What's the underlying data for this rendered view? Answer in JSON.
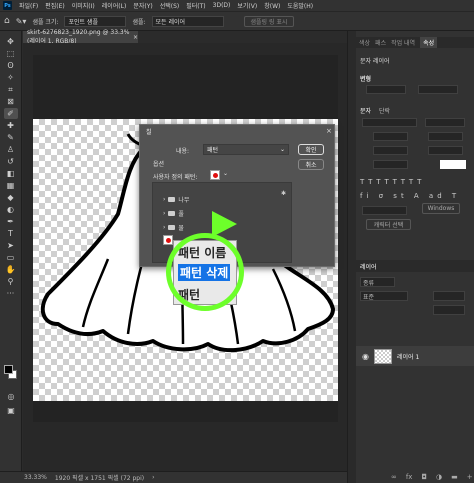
{
  "app": {
    "logo_text": "Ps"
  },
  "menubar": {
    "items": [
      "파일(F)",
      "편집(E)",
      "이미지(I)",
      "레이어(L)",
      "문자(Y)",
      "선택(S)",
      "필터(T)",
      "3D(D)",
      "보기(V)",
      "창(W)",
      "도움말(H)"
    ]
  },
  "options_bar": {
    "sample_size_label": "샘플 크기:",
    "sample_size_value": "포인트 샘플",
    "sample_label": "샘플:",
    "sample_value": "모든 레이어",
    "ring_button": "샘플링 링 표시"
  },
  "document": {
    "tab_label": "skirt-6276823_1920.png @ 33.3%(레이어 1, RGB/8)",
    "tab_close": "×"
  },
  "status_bar": {
    "zoom": "33.33%",
    "info": "1920 픽셀 x 1751 픽셀 (72 ppi)"
  },
  "right_panel": {
    "tabs": [
      "색상",
      "패스",
      "작업 내역",
      "속성"
    ],
    "active_tab": "속성",
    "section_title": "문자 레이어",
    "transform_label": "변형",
    "char_tabs": [
      "문자",
      "단락"
    ],
    "character_button": "캐릭터 선택",
    "windows_button": "Windows",
    "layers_title": "레이어",
    "layers_search": "종류",
    "blend_mode": "표준",
    "layer_name": "레이어 1"
  },
  "fill_dialog": {
    "title": "칠",
    "close": "×",
    "contents_label": "내용:",
    "contents_value": "패턴",
    "ok_button": "확인",
    "cancel_button": "취소",
    "options_label": "옵션",
    "custom_pattern_label": "사용자 정의 패턴:",
    "folders": [
      "나무",
      "풀",
      "물"
    ],
    "gear": "✱"
  },
  "context_menu": {
    "items": [
      "패턴 이름",
      "패턴 삭제",
      "패턴"
    ],
    "selected_index": 1
  },
  "colors": {
    "highlight_ring": "#6dff2a",
    "accent": "#1473e6",
    "pattern_swatch": "#e01010"
  }
}
